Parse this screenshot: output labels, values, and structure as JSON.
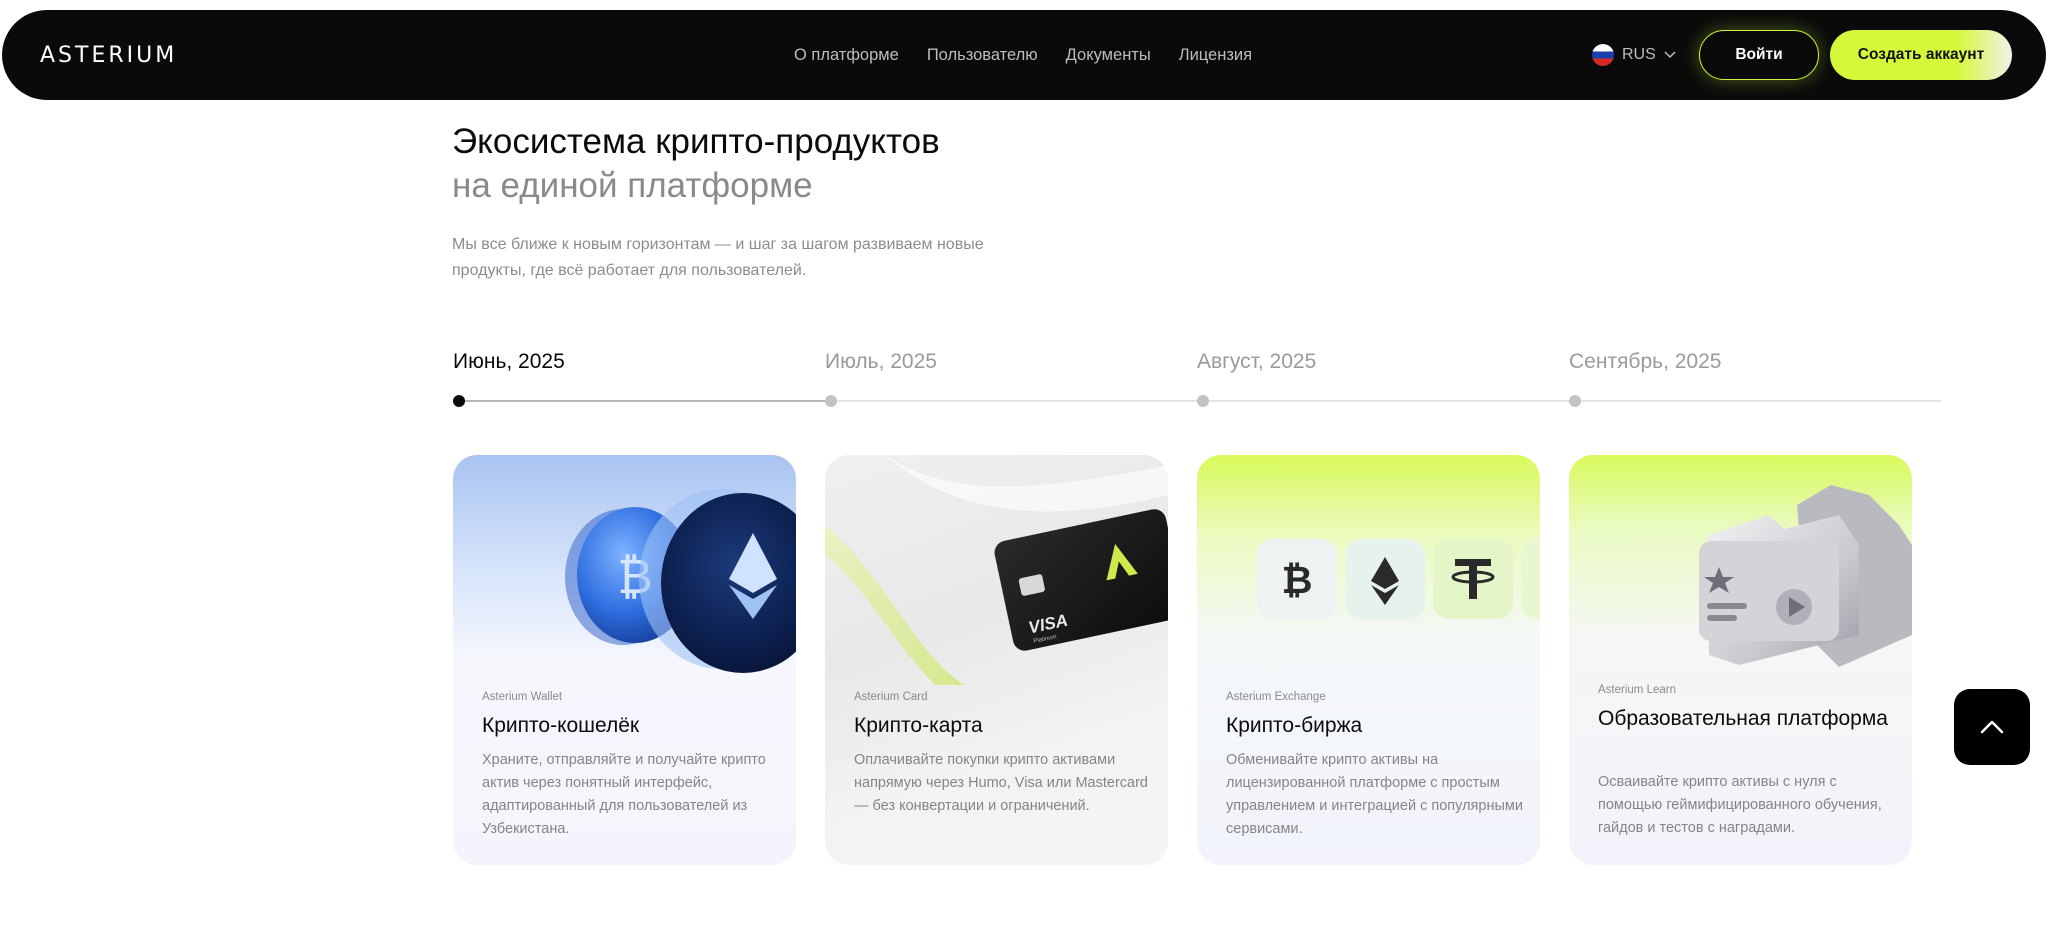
{
  "header": {
    "logo": "ASTERIUM",
    "nav": [
      "О платформе",
      "Пользователю",
      "Документы",
      "Лицензия"
    ],
    "language": "RUS",
    "login_label": "Войти",
    "signup_label": "Создать аккаунт"
  },
  "hero": {
    "title_line1": "Экосистема крипто-продуктов",
    "title_line2": "на единой платформе",
    "description": "Мы все ближе к новым горизонтам — и шаг за шагом развиваем новые продукты, где всё работает для пользователей."
  },
  "timeline": {
    "items": [
      "Июнь, 2025",
      "Июль, 2025",
      "Август, 2025",
      "Сентябрь, 2025"
    ],
    "active_index": 0
  },
  "cards": [
    {
      "subtitle": "Asterium Wallet",
      "title": "Крипто-кошелёк",
      "text": "Храните, отправляйте и получайте крипто актив через понятный интерфейс, адаптированный для пользователей из Узбекистана.",
      "icon": "coins-illustration"
    },
    {
      "subtitle": "Asterium Card",
      "title": "Крипто-карта",
      "text": "Оплачивайте покупки крипто активами напрямую через Humo, Visa или Mastercard — без конвертации и ограничений.",
      "icon": "bank-card-illustration",
      "card_brand": "VISA",
      "card_tier": "Platinum"
    },
    {
      "subtitle": "Asterium Exchange",
      "title": "Крипто-биржа",
      "text": "Обменивайте крипто активы на лицензированной платформе с простым управлением и интеграцией с популярными сервисами.",
      "icon": "exchange-tiles-illustration"
    },
    {
      "subtitle": "Asterium Learn",
      "title": "Образовательная платформа",
      "text": "Осваивайте крипто активы с нуля с помощью геймифицированного обучения, гайдов и тестов с наградами.",
      "icon": "learning-folder-illustration"
    }
  ],
  "colors": {
    "accent": "#d6f83b",
    "dark": "#0a0a0a",
    "muted_text": "#8a8a8a"
  }
}
